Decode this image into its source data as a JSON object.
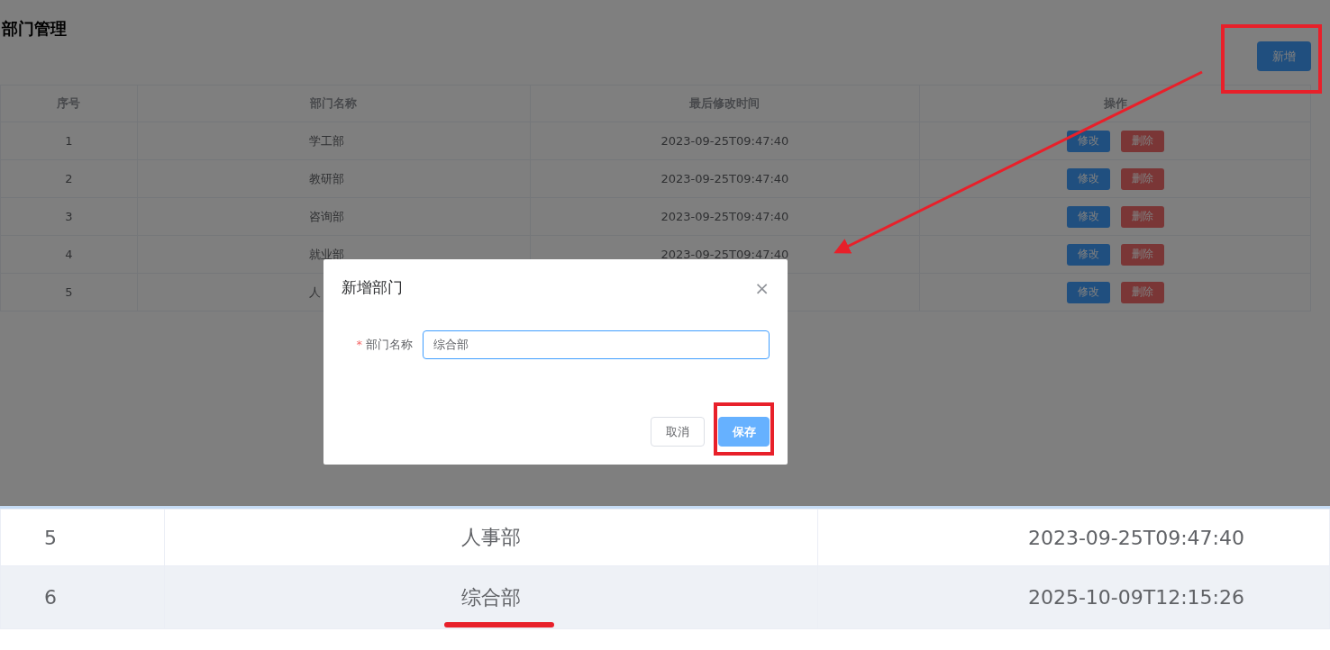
{
  "page": {
    "title": "部门管理",
    "add_button": "新增"
  },
  "table": {
    "columns": [
      "序号",
      "部门名称",
      "最后修改时间",
      "操作"
    ],
    "rows": [
      {
        "index": "1",
        "name": "学工部",
        "time": "2023-09-25T09:47:40",
        "actions": [
          {
            "label": "修改",
            "kind": "edit"
          },
          {
            "label": "删除",
            "kind": "delete"
          }
        ]
      },
      {
        "index": "2",
        "name": "教研部",
        "time": "2023-09-25T09:47:40",
        "actions": [
          {
            "label": "修改",
            "kind": "edit"
          },
          {
            "label": "删除",
            "kind": "delete"
          }
        ]
      },
      {
        "index": "3",
        "name": "咨询部",
        "time": "2023-09-25T09:47:40",
        "actions": [
          {
            "label": "修改",
            "kind": "edit"
          },
          {
            "label": "删除",
            "kind": "delete"
          }
        ]
      },
      {
        "index": "4",
        "name": "就业部",
        "time": "2023-09-25T09:47:40",
        "actions": [
          {
            "label": "修改",
            "kind": "edit"
          },
          {
            "label": "删除",
            "kind": "delete"
          }
        ]
      },
      {
        "index": "5",
        "name": "人",
        "actions": [
          {
            "label": "修改",
            "kind": "edit"
          },
          {
            "label": "删除",
            "kind": "delete"
          }
        ]
      }
    ]
  },
  "dialog": {
    "title": "新增部门",
    "close": "×",
    "field": {
      "label": "部门名称",
      "required_mark": "*",
      "value": "综合部"
    },
    "buttons": [
      {
        "label": "取消",
        "kind": "default"
      },
      {
        "label": "保存",
        "kind": "primary"
      }
    ]
  },
  "excerpt": {
    "rows": [
      {
        "index": "5",
        "name": "人事部",
        "time": "2023-09-25T09:47:40",
        "striped": false
      },
      {
        "index": "6",
        "name": "综合部",
        "time": "2025-10-09T12:15:26",
        "striped": true
      }
    ]
  }
}
